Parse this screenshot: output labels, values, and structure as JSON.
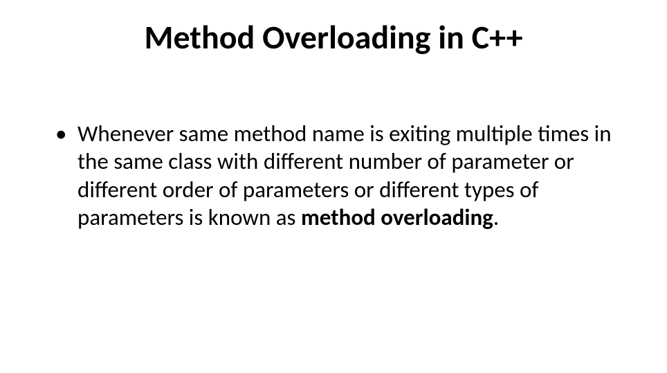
{
  "title": "Method Overloading in C++",
  "bullet_prefix": "Whenever same method name is exiting multiple times in the same class with different number of parameter or different order of parameters or different types of parameters is known as ",
  "bullet_strong": "method overloading",
  "bullet_suffix": "."
}
